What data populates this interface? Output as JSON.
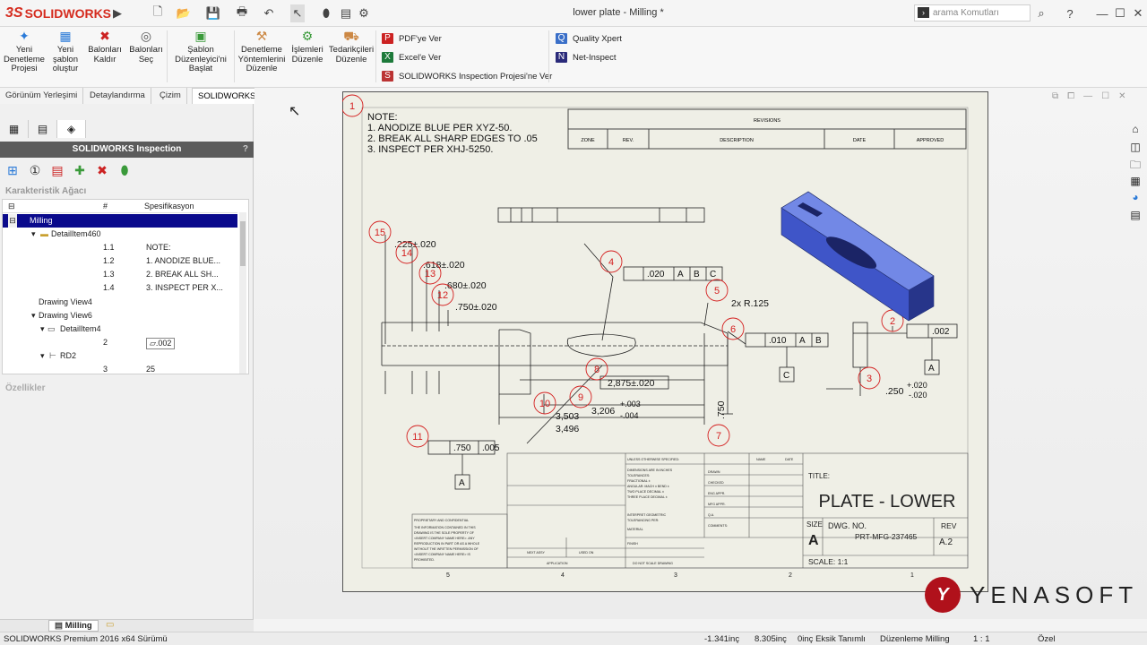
{
  "app": {
    "title": "lower plate - Milling *",
    "brand_prefix": "3S",
    "brand": "SOLIDWORKS",
    "search_placeholder": "arama Komutları"
  },
  "ribbon": {
    "buttons": [
      "Yeni Denetleme Projesi",
      "Yeni şablon oluştur",
      "Balonları Kaldır",
      "Balonları Seç",
      "Şablon Düzenleyici'ni Başlat",
      "Denetleme Yöntemlerini Düzenle",
      "İşlemleri Düzenle",
      "Tedarikçileri Düzenle"
    ],
    "export": [
      "PDF'ye Ver",
      "Excel'e Ver",
      "SOLIDWORKS Inspection Projesi'ne Ver"
    ],
    "other": [
      "Quality Xpert",
      "Net-Inspect"
    ]
  },
  "tabs": [
    "Görünüm Yerleşimi",
    "Detaylandırma",
    "Çizim",
    "SOLIDWORKS Inspection"
  ],
  "panel": {
    "header": "SOLIDWORKS Inspection",
    "help": "?",
    "tree_title": "Karakteristik Ağacı",
    "columns": [
      "#",
      "Spesifikasyon"
    ],
    "rows": [
      {
        "label": "Milling",
        "num": "",
        "spec": ""
      },
      {
        "label": "DetailItem460",
        "num": "",
        "spec": ""
      },
      {
        "label": "",
        "num": "1.1",
        "spec": "NOTE:"
      },
      {
        "label": "",
        "num": "1.2",
        "spec": "1. ANODIZE BLUE..."
      },
      {
        "label": "",
        "num": "1.3",
        "spec": "2. BREAK ALL SH..."
      },
      {
        "label": "",
        "num": "1.4",
        "spec": "3. INSPECT PER X..."
      },
      {
        "label": "Drawing View4",
        "num": "",
        "spec": ""
      },
      {
        "label": "Drawing View6",
        "num": "",
        "spec": ""
      },
      {
        "label": "DetailItem4",
        "num": "",
        "spec": ""
      },
      {
        "label": "",
        "num": "2",
        "spec": ".002"
      },
      {
        "label": "RD2",
        "num": "",
        "spec": ""
      },
      {
        "label": "",
        "num": "3",
        "spec": "25"
      }
    ],
    "properties_title": "Özellikler",
    "bottom_tab": "Milling"
  },
  "drawing": {
    "notes": [
      "NOTE:",
      "1.    ANODIZE BLUE PER XYZ-50.",
      "2.    BREAK ALL SHARP EDGES TO .05",
      "3.    INSPECT PER XHJ-5250."
    ],
    "revisions": {
      "title": "REVISIONS",
      "cols": [
        "ZONE",
        "REV.",
        "DESCRIPTION",
        "DATE",
        "APPROVED"
      ]
    },
    "balloons": [
      "1",
      "2",
      "3",
      "4",
      "5",
      "6",
      "7",
      "8",
      "9",
      "10",
      "11",
      "12",
      "13",
      "14",
      "15"
    ],
    "dims": [
      ".225±.020",
      ".618±.020",
      ".680±.020",
      ".750±.020",
      ".020",
      "A",
      "B",
      "C",
      "2x R.125",
      ".010",
      "A",
      "B",
      ".002",
      "A",
      ".250",
      "+.020",
      "-.020",
      "C",
      "2,875±.020",
      "3,206",
      "+.003",
      "-.004",
      "3,503",
      "3,496",
      ".750",
      ".005",
      "A",
      "B"
    ],
    "title_block": {
      "title_label": "TITLE:",
      "title": "PLATE - LOWER",
      "size_label": "SIZE",
      "size": "A",
      "dwg_label": "DWG. NO.",
      "dwg": "PRT-MFG-237465",
      "rev_label": "REV",
      "rev": "A.2",
      "scale": "SCALE: 1:1",
      "zones": [
        "5",
        "4",
        "3",
        "2",
        "1"
      ],
      "tiny": [
        "UNLESS OTHERWISE SPECIFIED:",
        "NAME",
        "DATE",
        "DIMENSIONS ARE IN INCHES",
        "TOLERANCES:",
        "FRACTIONAL ±",
        "ANGULAR: MACH ±    BEND ±",
        "TWO PLACE DECIMAL  ±",
        "THREE PLACE DECIMAL  ±",
        "DRAWN",
        "CHECKED",
        "ENG APPR.",
        "MFG APPR.",
        "Q.A.",
        "COMMENTS:",
        "INTERPRET GEOMETRIC",
        "TOLERANCING PER:",
        "MATERIAL",
        "FINISH",
        "NEXT ASSY",
        "USED ON",
        "APPLICATION",
        "DO NOT SCALE DRAWING",
        "PROPRIETARY AND CONFIDENTIAL",
        "THE INFORMATION CONTAINED IN THIS",
        "DRAWING IS THE SOLE PROPERTY OF",
        "<INSERT COMPANY NAME HERE>. ANY",
        "REPRODUCTION IN PART OR AS A WHOLE",
        "WITHOUT THE WRITTEN PERMISSION OF",
        "<INSERT COMPANY NAME HERE> IS",
        "PROHIBITED."
      ]
    }
  },
  "status": [
    "SOLIDWORKS Premium 2016 x64 Sürümü",
    "-1.341inç",
    "8.305inç",
    "0inç Eksik Tanımlı",
    "Düzenleme Milling",
    "1 : 1",
    "Özel"
  ],
  "watermark": "YENASOFT",
  "colors": {
    "accent": "#0a0a8c",
    "balloon": "#d42020",
    "part": "#3f55c8"
  }
}
